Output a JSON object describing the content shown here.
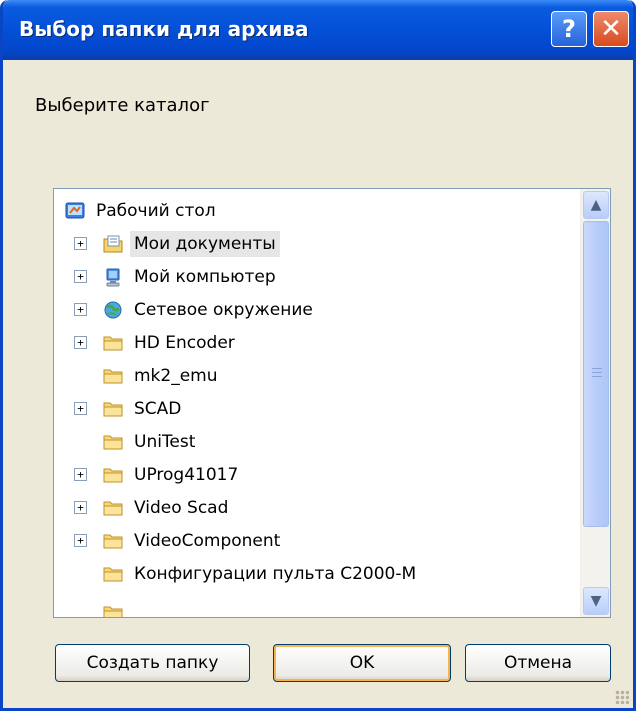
{
  "window": {
    "title": "Выбор папки для архива",
    "help_label": "?",
    "close_label": "✕"
  },
  "prompt": "Выберите каталог",
  "tree": {
    "items": [
      {
        "label": "Рабочий стол",
        "icon": "desktop-icon",
        "expander": ""
      },
      {
        "label": "Мои документы",
        "icon": "my-documents-icon",
        "expander": "+",
        "selected": true
      },
      {
        "label": "Мой компьютер",
        "icon": "my-computer-icon",
        "expander": "+"
      },
      {
        "label": "Сетевое окружение",
        "icon": "network-icon",
        "expander": "+"
      },
      {
        "label": "HD Encoder",
        "icon": "folder-icon",
        "expander": "+"
      },
      {
        "label": "mk2_emu",
        "icon": "folder-icon",
        "expander": ""
      },
      {
        "label": "SCAD",
        "icon": "folder-icon",
        "expander": "+"
      },
      {
        "label": "UniTest",
        "icon": "folder-icon",
        "expander": ""
      },
      {
        "label": "UProg41017",
        "icon": "folder-icon",
        "expander": "+"
      },
      {
        "label": "Video Scad",
        "icon": "folder-icon",
        "expander": "+"
      },
      {
        "label": "VideoComponent",
        "icon": "folder-icon",
        "expander": "+"
      },
      {
        "label": "Конфигурации пульта С2000-М",
        "icon": "folder-icon",
        "expander": ""
      }
    ]
  },
  "scrollbar": {
    "up_label": "▲",
    "down_label": "▼"
  },
  "buttons": {
    "new_folder": "Создать папку",
    "ok": "OK",
    "cancel": "Отмена"
  },
  "colors": {
    "titlebar": "#0450d6",
    "dialog_bg": "#ece9d8",
    "tree_border": "#7f9db9",
    "ok_focus": "#f8b34c"
  }
}
